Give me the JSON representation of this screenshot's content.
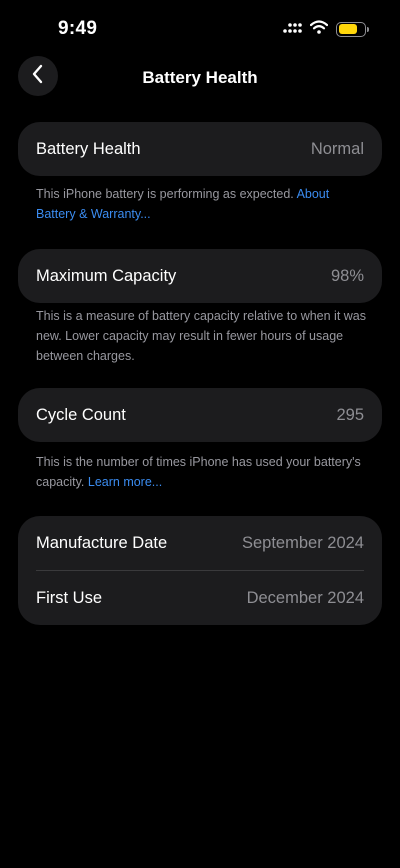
{
  "status_bar": {
    "time": "9:49",
    "battery_color": "#ffd60a"
  },
  "nav": {
    "title": "Battery Health",
    "back_icon": "chevron-left-icon"
  },
  "battery_health": {
    "label": "Battery Health",
    "value": "Normal",
    "note": "This iPhone battery is performing as expected. ",
    "note_link": "About Battery & Warranty..."
  },
  "maximum_capacity": {
    "label": "Maximum Capacity",
    "value": "98%",
    "note": "This is a measure of battery capacity relative to when it was new. Lower capacity may result in fewer hours of usage between charges."
  },
  "cycle_count": {
    "label": "Cycle Count",
    "value": "295",
    "note": "This is the number of times iPhone has used your battery's capacity. ",
    "note_link": "Learn more..."
  },
  "dates": {
    "manufacture_label": "Manufacture Date",
    "manufacture_value": "September 2024",
    "first_use_label": "First Use",
    "first_use_value": "December 2024"
  },
  "colors": {
    "background": "#000000",
    "card": "#1c1c1e",
    "link": "#3b8cf0",
    "secondary_text": "#8e8e93"
  }
}
